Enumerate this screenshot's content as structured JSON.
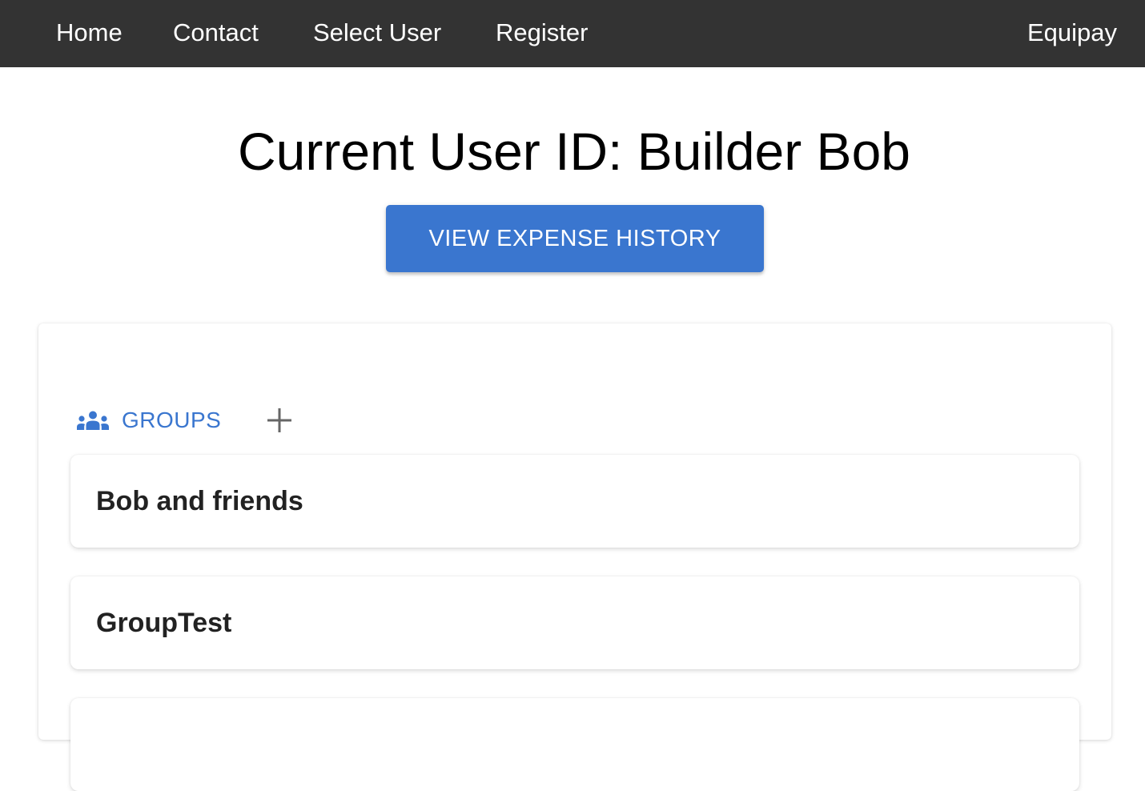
{
  "nav": {
    "links": [
      "Home",
      "Contact",
      "Select User",
      "Register"
    ],
    "brand": "Equipay"
  },
  "main": {
    "title": "Current User ID: Builder Bob",
    "view_history_label": "VIEW EXPENSE HISTORY"
  },
  "tabs": {
    "groups_label": "GROUPS",
    "groups_icon": "groups-icon",
    "add_icon": "plus-icon"
  },
  "groups": [
    {
      "name": "Bob and friends"
    },
    {
      "name": "GroupTest"
    },
    {
      "name": ""
    }
  ],
  "colors": {
    "navbar": "#333333",
    "accent": "#3a76cf",
    "add_icon": "#666666"
  }
}
